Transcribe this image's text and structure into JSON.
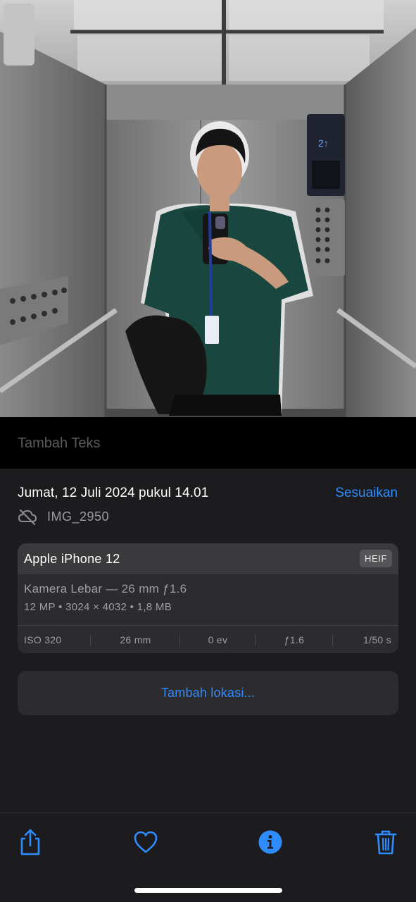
{
  "photo": {
    "icon": "selfie-photo",
    "alt": ""
  },
  "caption": {
    "placeholder": "Tambah Teks"
  },
  "info": {
    "datetime": "Jumat, 12 Juli 2024 pukul 14.01",
    "adjust_label": "Sesuaikan",
    "file_icon": "cloud-off-icon",
    "file_name": "IMG_2950"
  },
  "device": {
    "name": "Apple iPhone 12",
    "format": "HEIF",
    "lens": "Kamera Lebar — 26 mm ƒ1.6",
    "specs": "12 MP  •  3024 × 4032  •  1,8 MB",
    "exif": {
      "iso": "ISO 320",
      "focal": "26 mm",
      "exposure": "0 ev",
      "aperture": "ƒ1.6",
      "shutter": "1/50 s"
    }
  },
  "location": {
    "label": "Tambah lokasi..."
  },
  "toolbar": {
    "share_icon": "share-icon",
    "favorite_icon": "heart-icon",
    "info_icon": "info-icon",
    "delete_icon": "trash-icon"
  },
  "colors": {
    "accent": "#2f8cff",
    "panel": "#1c1c1e",
    "card": "#2c2c2e",
    "card_header": "#3a3a3c"
  }
}
